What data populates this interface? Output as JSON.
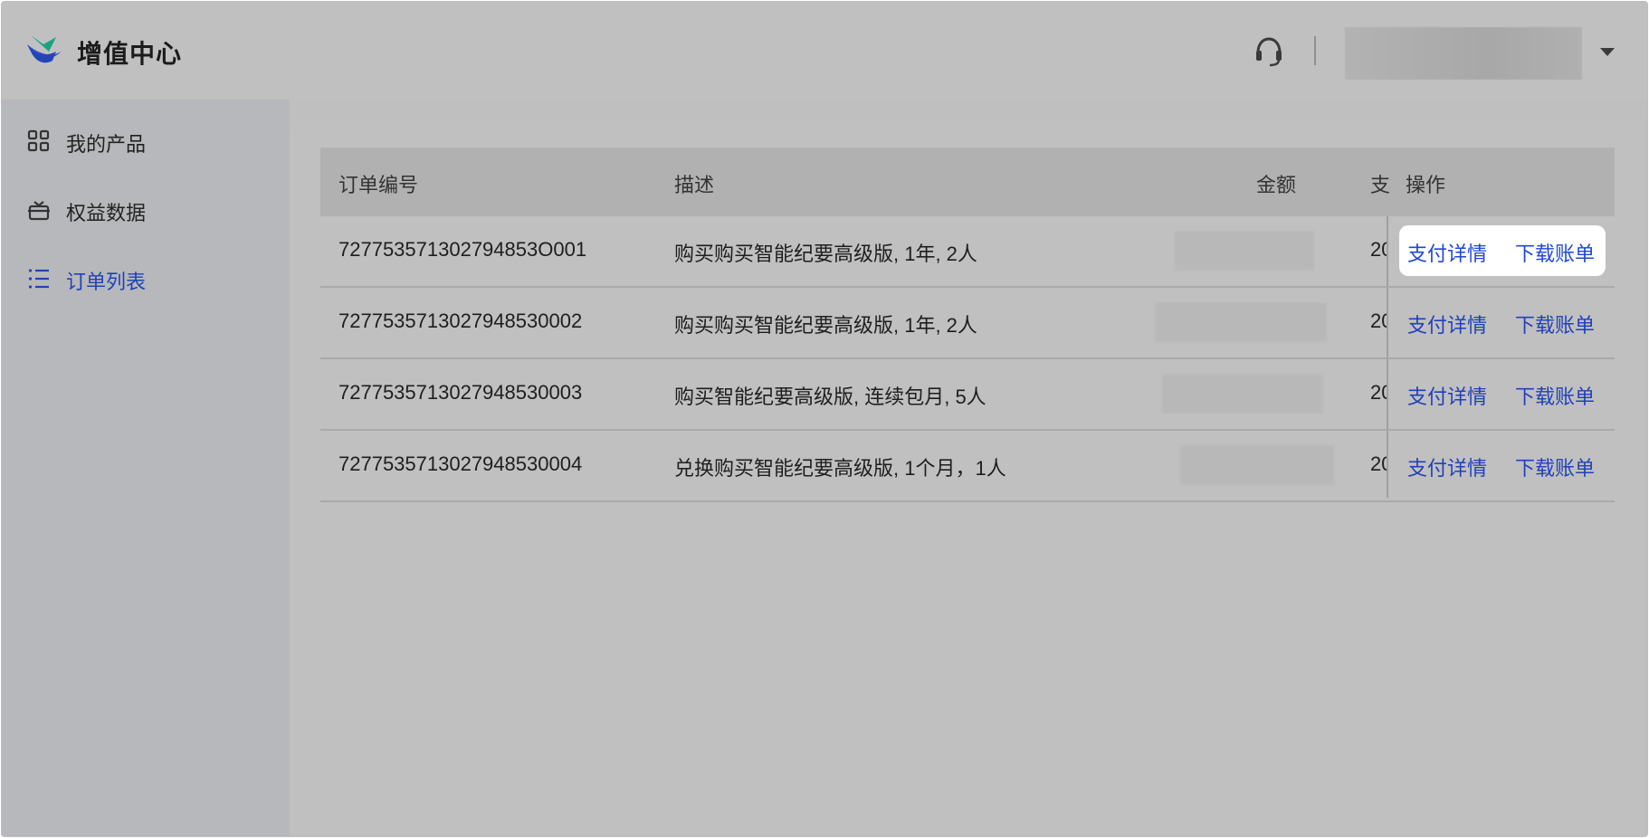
{
  "app": {
    "title": "增值中心"
  },
  "header": {
    "support_icon": "headset-icon",
    "caret_icon": "caret-down-icon"
  },
  "sidebar": {
    "items": [
      {
        "label": "我的产品",
        "icon": "grid-icon",
        "active": false
      },
      {
        "label": "权益数据",
        "icon": "gift-icon",
        "active": false
      },
      {
        "label": "订单列表",
        "icon": "list-icon",
        "active": true
      }
    ]
  },
  "table": {
    "columns": [
      "订单编号",
      "描述",
      "金额",
      "支",
      "操作"
    ],
    "rows": [
      {
        "order_no": "727753571302794853O001",
        "desc": "购买购买智能纪要高级版, 1年, 2人",
        "date_prefix": "20",
        "op1": "支付详情",
        "op2": "下载账单"
      },
      {
        "order_no": "7277535713027948530002",
        "desc": "购买购买智能纪要高级版, 1年, 2人",
        "date_prefix": "20",
        "op1": "支付详情",
        "op2": "下载账单"
      },
      {
        "order_no": "7277535713027948530003",
        "desc": "购买智能纪要高级版, 连续包月, 5人",
        "date_prefix": "20",
        "op1": "支付详情",
        "op2": "下载账单"
      },
      {
        "order_no": "7277535713027948530004",
        "desc": "兑换购买智能纪要高级版, 1个月，1人",
        "date_prefix": "20",
        "op1": "支付详情",
        "op2": "下载账单"
      }
    ]
  },
  "colors": {
    "accent": "#1f43b6",
    "link": "#2140bb",
    "highlight": "#ffffff"
  }
}
